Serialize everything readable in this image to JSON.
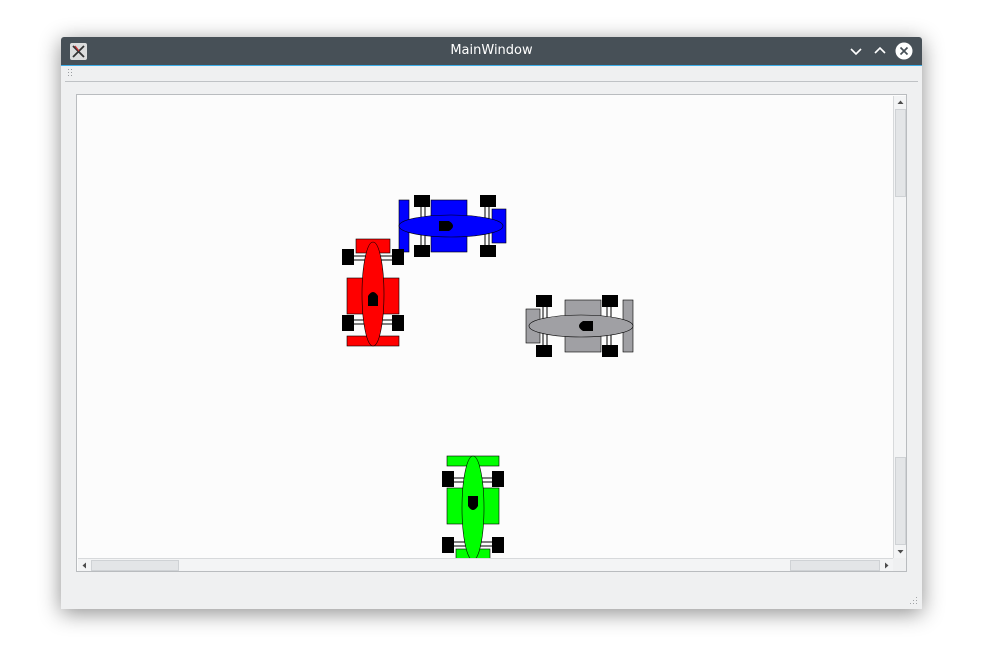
{
  "window": {
    "title": "MainWindow",
    "accent_color": "#3daee9",
    "titlebar_color": "#475057"
  },
  "titlebar_buttons": [
    "minimize-icon",
    "maximize-icon",
    "close-icon"
  ],
  "scene": {
    "background": "#fcfcfc",
    "cars": [
      {
        "name": "car-blue",
        "color": "#0000ff",
        "heading": "left"
      },
      {
        "name": "car-red",
        "color": "#ff0000",
        "heading": "down"
      },
      {
        "name": "car-gray",
        "color": "#a0a0a4",
        "heading": "right"
      },
      {
        "name": "car-green",
        "color": "#00ff00",
        "heading": "up"
      }
    ]
  },
  "scrollbars": {
    "vertical": {
      "icons": [
        "arrow-up-icon",
        "arrow-down-icon"
      ]
    },
    "horizontal": {
      "icons": [
        "arrow-left-icon",
        "arrow-right-icon"
      ]
    }
  }
}
